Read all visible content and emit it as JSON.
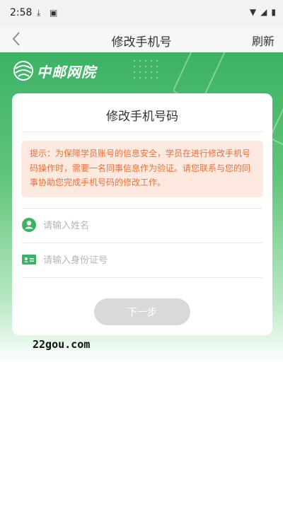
{
  "status_bar": {
    "time": "2:58"
  },
  "nav": {
    "title": "修改手机号",
    "refresh_label": "刷新"
  },
  "brand": {
    "logo_text": "中邮网院"
  },
  "card": {
    "title": "修改手机号码",
    "notice": "提示：为保障学员账号的信息安全，学员在进行修改手机号码操作时，需要一名同事信息作为验证。请您联系与您的同事协助您完成手机号码的修改工作。",
    "name_placeholder": "请输入姓名",
    "id_placeholder": "请输入身份证号",
    "next_label": "下一步"
  },
  "watermark": "22gou.com",
  "colors": {
    "brand_green": "#3cb264",
    "notice_bg": "#fde9df",
    "notice_text": "#e8713a",
    "button_disabled": "#d9d9d9"
  }
}
